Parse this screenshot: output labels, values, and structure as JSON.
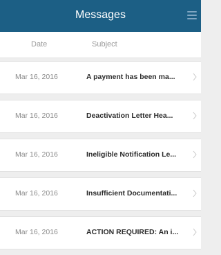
{
  "header": {
    "title": "Messages",
    "menu_icon": "hamburger-menu-icon"
  },
  "columns": {
    "date": "Date",
    "subject": "Subject"
  },
  "messages": [
    {
      "date": "Mar 16, 2016",
      "subject": "A payment has been ma..."
    },
    {
      "date": "Mar 16, 2016",
      "subject": "Deactivation Letter Hea..."
    },
    {
      "date": "Mar 16, 2016",
      "subject": "Ineligible Notification Le..."
    },
    {
      "date": "Mar 16, 2016",
      "subject": "Insufficient Documentati..."
    },
    {
      "date": "Mar 16, 2016",
      "subject": "ACTION REQUIRED: An i..."
    }
  ],
  "colors": {
    "header_bg": "#1c5f85",
    "page_bg": "#eeeeee"
  }
}
